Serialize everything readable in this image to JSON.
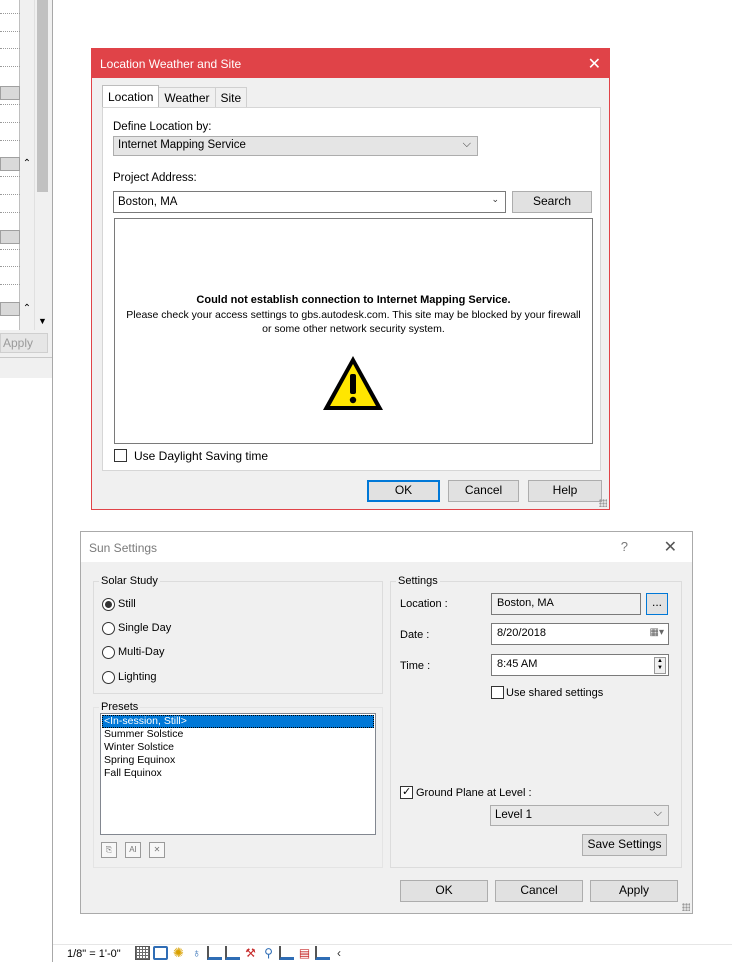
{
  "background": {
    "apply_label": "Apply",
    "scale_label": "1/8\" = 1'-0\"",
    "collapse_icon": "double-chevron-up",
    "scroll_down_icon": "chevron-down"
  },
  "location_dialog": {
    "title": "Location Weather and Site",
    "close_glyph": "✕",
    "tabs": [
      "Location",
      "Weather",
      "Site"
    ],
    "define_location_label": "Define Location by:",
    "define_location_value": "Internet Mapping Service",
    "project_address_label": "Project Address:",
    "project_address_value": "Boston, MA",
    "search_label": "Search",
    "error_title": "Could not establish connection to Internet Mapping Service.",
    "error_line1": "Please check your access settings to gbs.autodesk.com. This site may be blocked by your firewall",
    "error_line2": "or some other network security system.",
    "daylight_label": "Use Daylight Saving time",
    "daylight_checked": false,
    "ok_label": "OK",
    "cancel_label": "Cancel",
    "help_label": "Help",
    "accent_color": "#e04348"
  },
  "sun_dialog": {
    "title": "Sun Settings",
    "help_glyph": "?",
    "close_glyph": "✕",
    "solar_study_label": "Solar Study",
    "solar_options": [
      "Still",
      "Single Day",
      "Multi-Day",
      "Lighting"
    ],
    "solar_selected": "Still",
    "presets_label": "Presets",
    "presets": [
      "<In-session, Still>",
      "Summer Solstice",
      "Winter Solstice",
      "Spring Equinox",
      "Fall Equinox"
    ],
    "presets_selected": "<In-session, Still>",
    "settings_label": "Settings",
    "location_label": "Location :",
    "location_value": "Boston, MA",
    "browse_label": "...",
    "date_label": "Date :",
    "date_value": "8/20/2018",
    "time_label": "Time :",
    "time_value": "8:45 AM",
    "shared_label": "Use shared settings",
    "shared_checked": false,
    "ground_plane_label": "Ground Plane at Level :",
    "ground_plane_checked": true,
    "level_value": "Level 1",
    "save_settings_label": "Save Settings",
    "ok_label": "OK",
    "cancel_label": "Cancel",
    "apply_label": "Apply",
    "selection_color": "#0078d7"
  }
}
